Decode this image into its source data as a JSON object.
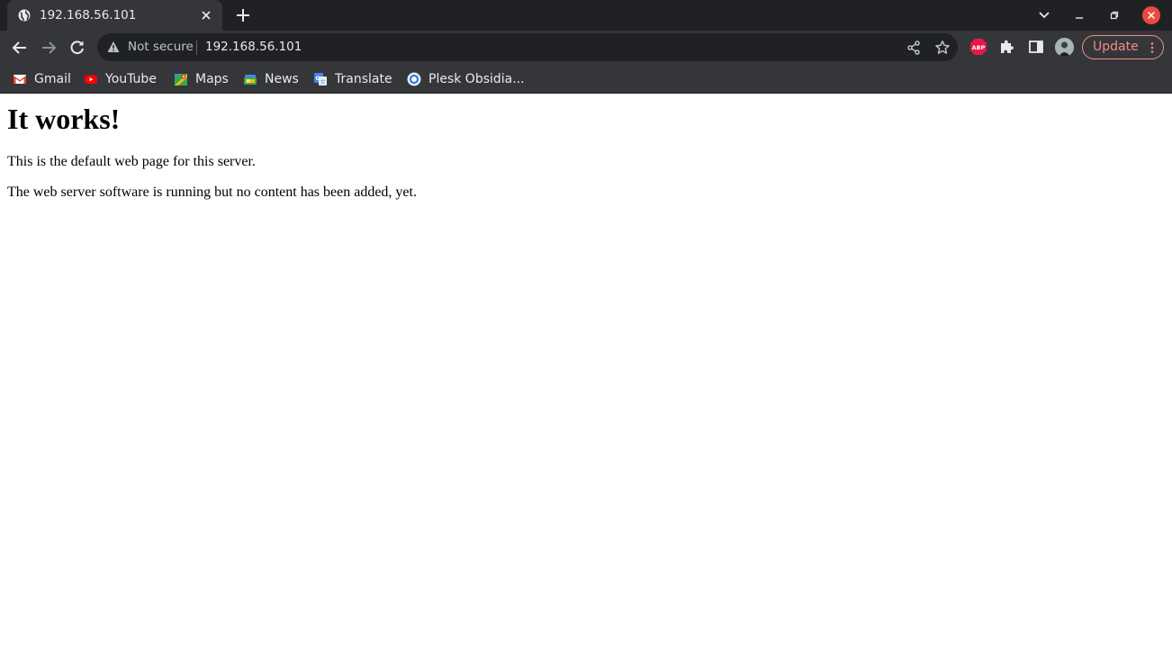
{
  "tab": {
    "title": "192.168.56.101",
    "favicon": "globe-icon"
  },
  "toolbar": {
    "security_label": "Not secure",
    "url": "192.168.56.101",
    "update_label": "Update"
  },
  "bookmarks": [
    {
      "label": "Gmail",
      "icon": "gmail-icon"
    },
    {
      "label": "YouTube",
      "icon": "youtube-icon"
    },
    {
      "label": "Maps",
      "icon": "maps-icon"
    },
    {
      "label": "News",
      "icon": "news-icon"
    },
    {
      "label": "Translate",
      "icon": "translate-icon"
    },
    {
      "label": "Plesk Obsidia...",
      "icon": "plesk-icon"
    }
  ],
  "page": {
    "heading": "It works!",
    "paragraphs": [
      "This is the default web page for this server.",
      "The web server software is running but no content has been added, yet."
    ]
  },
  "colors": {
    "tabstrip_bg": "#202124",
    "toolbar_bg": "#35363a",
    "update_accent": "#f28b82",
    "close_button": "#e94b3c",
    "abp_badge": "#e8174a"
  }
}
